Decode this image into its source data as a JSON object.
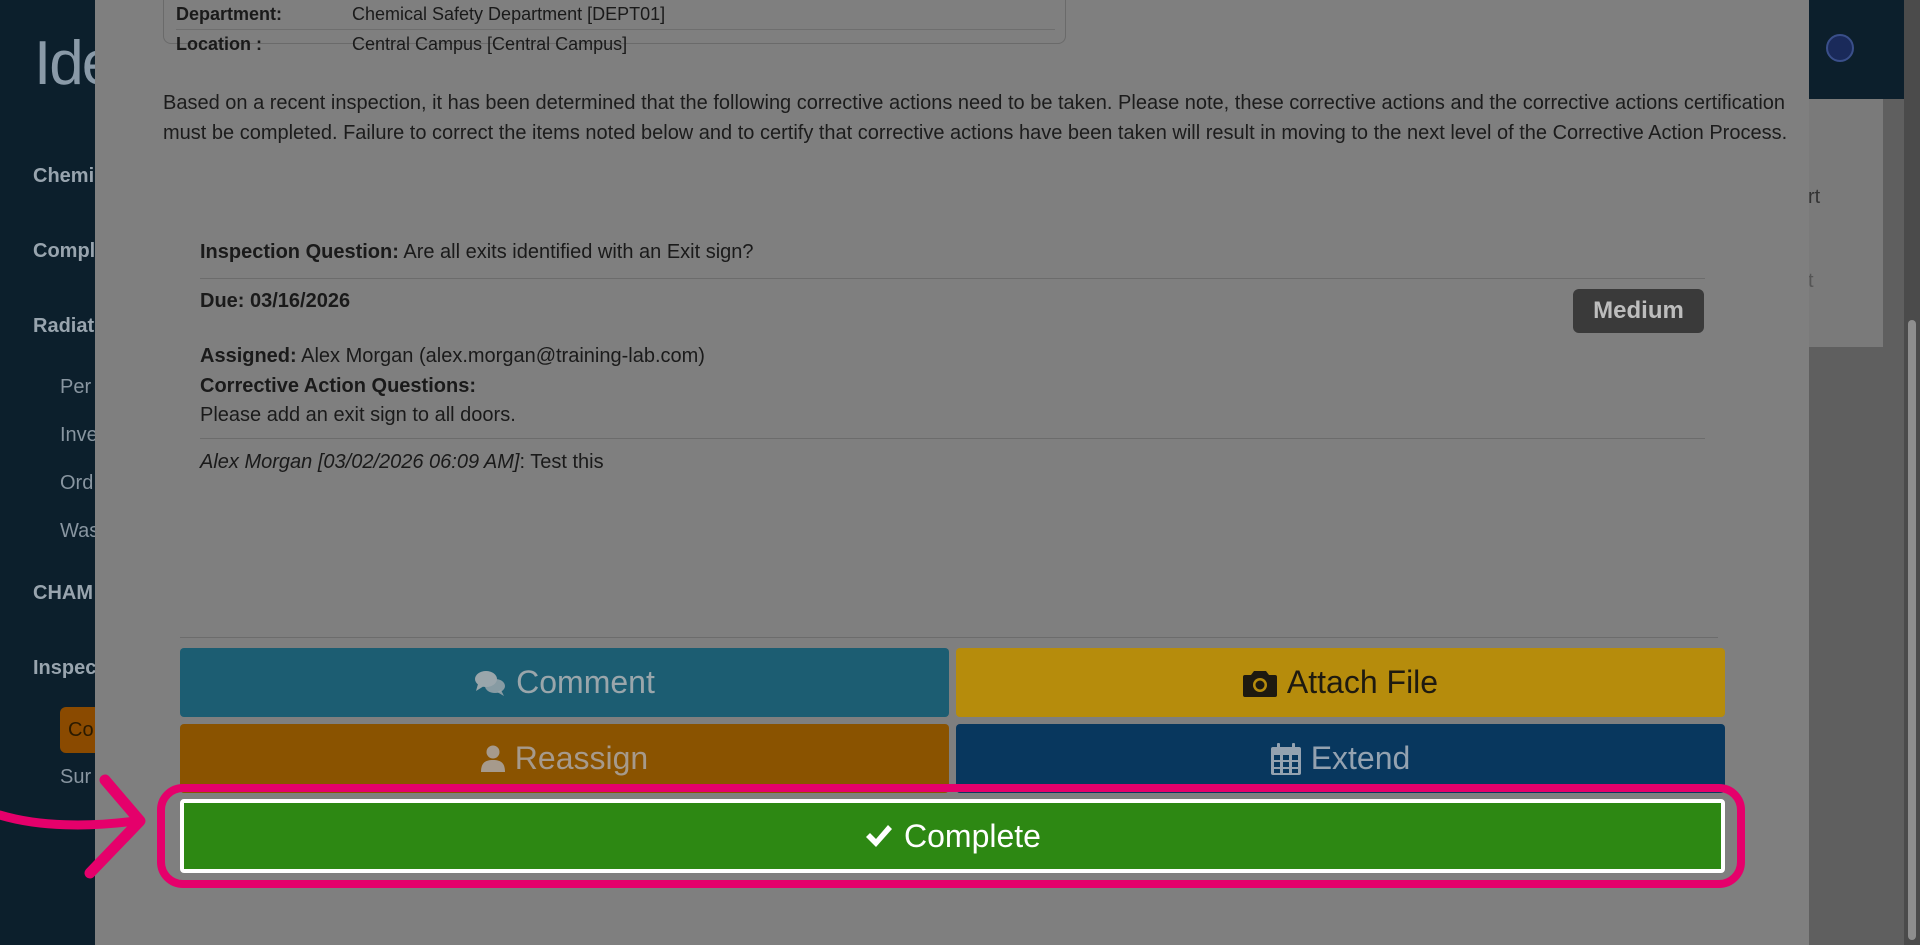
{
  "background": {
    "logo_text": "Ide",
    "nav": [
      {
        "label": "Chemi"
      },
      {
        "label": "Compl"
      },
      {
        "label": "Radiat"
      },
      {
        "label": "CHAM"
      },
      {
        "label": "Inspec"
      }
    ],
    "subnav": [
      {
        "label": "Per"
      },
      {
        "label": "Inve"
      },
      {
        "label": "Ord"
      },
      {
        "label": "Was"
      },
      {
        "label": "Sur"
      }
    ],
    "active_item": "Co",
    "card_text1": "rt",
    "card_text2": "t"
  },
  "modal": {
    "info": {
      "department_label": "Department:",
      "department_value": "Chemical Safety Department [DEPT01]",
      "location_label": "Location :",
      "location_value": "Central Campus [Central Campus]"
    },
    "intro": "Based on a recent inspection, it has been determined that the following corrective actions need to be taken. Please note, these corrective actions and the corrective actions certification must be completed. Failure to correct the items noted below and to certify that corrective actions have been taken will result in moving to the next level of the Corrective Action Process.",
    "item": {
      "question_label": "Inspection Question:",
      "question_text": "Are all exits identified with an Exit sign?",
      "due": "Due: 03/16/2026",
      "priority": "Medium",
      "assigned_label": "Assigned:",
      "assigned_text": "Alex Morgan (alex.morgan@training-lab.com)",
      "caq_label": "Corrective Action Questions:",
      "caq_text": "Please add an exit sign to all doors.",
      "comment_author": "Alex Morgan [03/02/2026 06:09 AM]",
      "comment_text": ": Test this"
    },
    "buttons": {
      "comment": "Comment",
      "attach": "Attach File",
      "reassign": "Reassign",
      "extend": "Extend",
      "complete": "Complete"
    }
  },
  "colors": {
    "highlight": "#e5006b",
    "complete": "#2d8813",
    "comment": "#1c5d72",
    "attach": "#b68c0c",
    "reassign": "#8a5300",
    "extend": "#08375e"
  }
}
